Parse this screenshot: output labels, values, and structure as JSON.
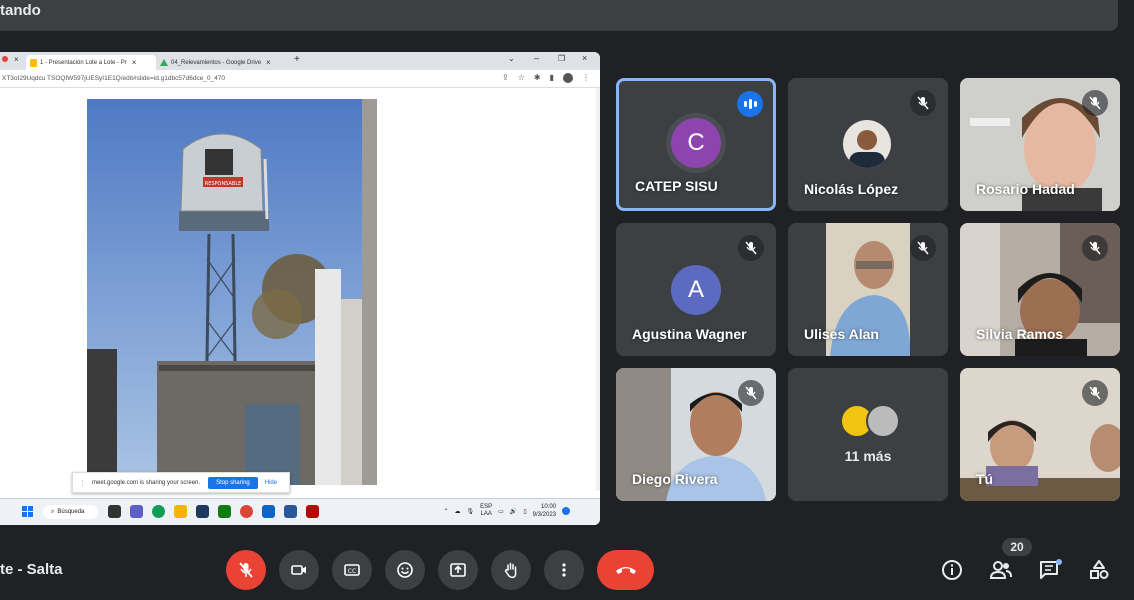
{
  "header": {
    "title": "tando"
  },
  "browser": {
    "tabs": [
      {
        "label": "1 - Presentación Lote a Lote - Pr",
        "close": "×"
      },
      {
        "label": "04_Relevamientos - Google Drive",
        "close": "×"
      }
    ],
    "new_tab": "+",
    "url": "XT3oI29Uqdcu TSOQIW597jUESyI1E1Q/edit#slide=id.g1dbc57d6dce_0_470",
    "sharing_bar": {
      "message": "meet.google.com is sharing your screen.",
      "stop": "Stop sharing",
      "hide": "Hide"
    },
    "taskbar": {
      "search": "Búsqueda",
      "lang": "ESP",
      "lang2": "LAA",
      "time": "10:00",
      "date": "9/3/2023"
    },
    "slide_photo": {
      "tank_label": "RESPONSABLE"
    }
  },
  "participants": [
    {
      "name": "CATEP SISU",
      "initial": "C",
      "avatar_color": "#8e44ad",
      "speaking": true
    },
    {
      "name": "Nicolás López",
      "muted": true
    },
    {
      "name": "Rosario Hadad",
      "muted": true
    },
    {
      "name": "Agustina Wagner",
      "initial": "A",
      "avatar_color": "#5c6bc0",
      "muted": true
    },
    {
      "name": "Ulises Alan",
      "muted": true
    },
    {
      "name": "Silvia Ramos",
      "muted": true
    },
    {
      "name": "Diego Rivera",
      "muted": true
    },
    {
      "name": "11 más"
    },
    {
      "name": "Tú",
      "muted": true
    }
  ],
  "meeting": {
    "name": "te - Salta"
  },
  "participant_count": "20",
  "colors": {
    "accent": "#8ab4f8",
    "danger": "#ea4335",
    "tile": "#3c4043",
    "bg": "#202124"
  }
}
